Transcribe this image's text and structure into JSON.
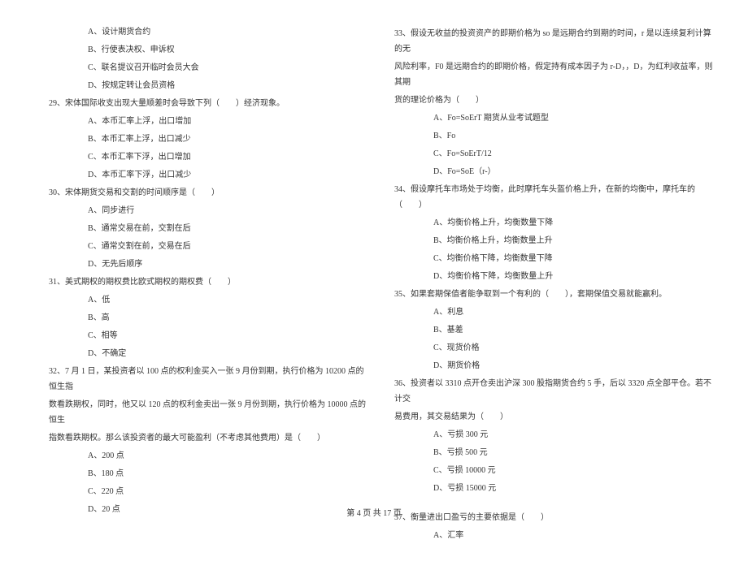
{
  "left_column": {
    "pre_options": [
      "A、设计期货合约",
      "B、行使表决权、申诉权",
      "C、联名提议召开临时会员大会",
      "D、按规定转让会员资格"
    ],
    "q29": {
      "text": "29、宋体国际收支出现大量顺差时会导致下列（　　）经济现象。",
      "options": [
        "A、本币汇率上浮，出口增加",
        "B、本币汇率上浮，出口减少",
        "C、本币汇率下浮，出口增加",
        "D、本币汇率下浮，出口减少"
      ]
    },
    "q30": {
      "text": "30、宋体期货交易和交割的时间顺序是（　　）",
      "options": [
        "A、同步进行",
        "B、通常交易在前，交割在后",
        "C、通常交割在前，交易在后",
        "D、无先后顺序"
      ]
    },
    "q31": {
      "text": "31、美式期权的期权费比欧式期权的期权费（　　）",
      "options": [
        "A、低",
        "B、高",
        "C、相等",
        "D、不确定"
      ]
    },
    "q32": {
      "text1": "32、7 月 1 日，某投资者以 100 点的权利金买入一张 9 月份到期，执行价格为 10200 点的恒生指",
      "text2": "数看跌期权，同时，他又以 120 点的权利金卖出一张 9 月份到期，执行价格为 10000 点的恒生",
      "text3": "指数看跌期权。那么该投资者的最大可能盈利（不考虑其他费用）是（　　）",
      "options": [
        "A、200 点",
        "B、180 点",
        "C、220 点",
        "D、20 点"
      ]
    }
  },
  "right_column": {
    "q33": {
      "text1": "33、假设无收益的投资资产的即期价格为 so 是远期合约到期的时间，r 是以连续复利计算的无",
      "text2": "风险利率，F0 是远期合约的即期价格，假定持有成本因子为 r-D，，D，为红利收益率，则其期",
      "text3": "货的理论价格为（　　）",
      "options": [
        "A、Fo=SoErT 期货从业考试题型",
        "B、Fo",
        "C、Fo=SoErT/12",
        "D、Fo=SoE（r-）"
      ]
    },
    "q34": {
      "text": "34、假设摩托车市场处于均衡，此时摩托车头盔价格上升，在新的均衡中，摩托车的（　　）",
      "options": [
        "A、均衡价格上升，均衡数量下降",
        "B、均衡价格上升，均衡数量上升",
        "C、均衡价格下降，均衡数量下降",
        "D、均衡价格下降，均衡数量上升"
      ]
    },
    "q35": {
      "text": "35、如果套期保值者能争取到一个有利的（　　），套期保值交易就能赢利。",
      "options": [
        "A、利息",
        "B、基差",
        "C、现货价格",
        "D、期货价格"
      ]
    },
    "q36": {
      "text1": "36、投资者以 3310 点开仓卖出沪深 300 股指期货合约 5 手，后以 3320 点全部平仓。若不计交",
      "text2": "易费用，其交易结果为（　　）",
      "options": [
        "A、亏损 300 元",
        "B、亏损 500 元",
        "C、亏损 10000 元",
        "D、亏损 15000 元"
      ]
    },
    "q37": {
      "text": "37、衡量进出口盈亏的主要依据是（　　）",
      "options": [
        "A、汇率"
      ]
    }
  },
  "footer": "第 4 页 共 17 页"
}
